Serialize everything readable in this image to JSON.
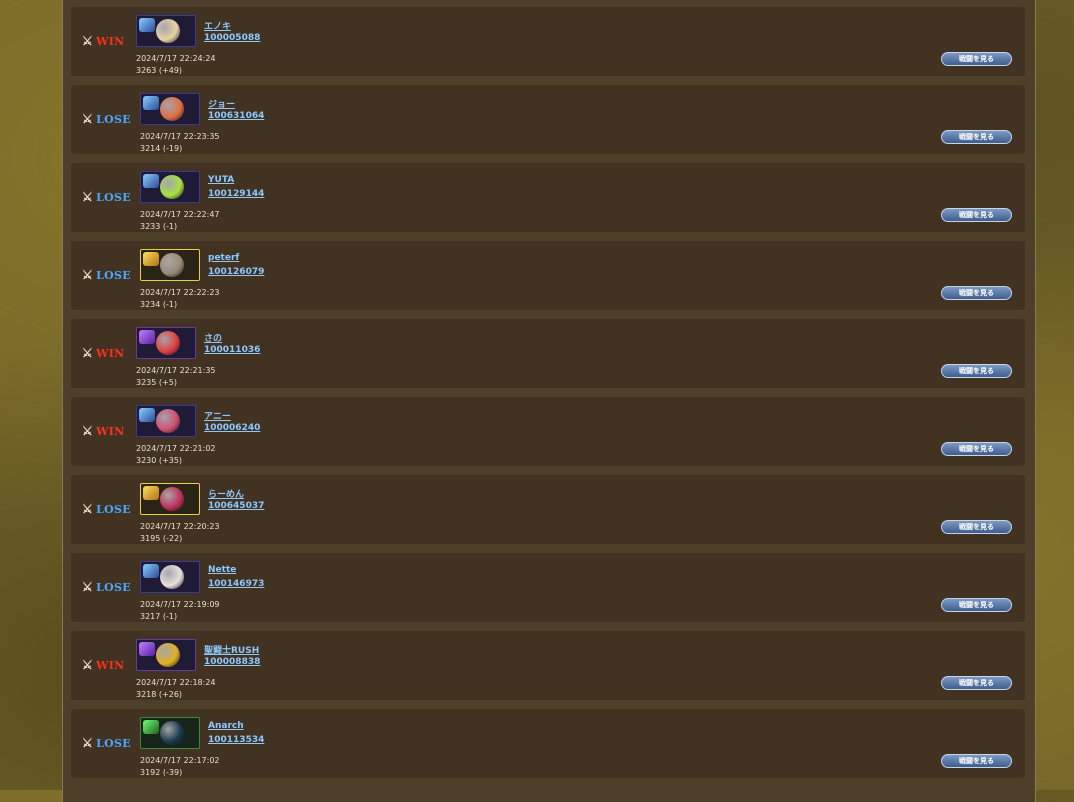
{
  "battles": [
    {
      "result": "WIN",
      "name": "エノキ",
      "player_id": "100005088",
      "time": "2024/7/17 22:24:24",
      "rating": "3263 (+49)",
      "button": "戦闘を見る",
      "frame": "blue",
      "orb": "#e8d2a0"
    },
    {
      "result": "LOSE",
      "name": "ジョー",
      "player_id": "100631064",
      "time": "2024/7/17 22:23:35",
      "rating": "3214 (-19)",
      "button": "戦闘を見る",
      "frame": "blue",
      "orb": "#e07040"
    },
    {
      "result": "LOSE",
      "name": "YUTA",
      "player_id": "100129144",
      "time": "2024/7/17 22:22:47",
      "rating": "3233 (-1)",
      "button": "戦闘を見る",
      "frame": "blue",
      "orb": "#a8e040"
    },
    {
      "result": "LOSE",
      "name": "peterf",
      "player_id": "100126079",
      "time": "2024/7/17 22:22:23",
      "rating": "3234 (-1)",
      "button": "戦闘を見る",
      "frame": "gold",
      "orb": "#9a8a7a"
    },
    {
      "result": "WIN",
      "name": "さの",
      "player_id": "100011036",
      "time": "2024/7/17 22:21:35",
      "rating": "3235 (+5)",
      "button": "戦闘を見る",
      "frame": "purple",
      "orb": "#e04040"
    },
    {
      "result": "WIN",
      "name": "アニー",
      "player_id": "100006240",
      "time": "2024/7/17 22:21:02",
      "rating": "3230 (+35)",
      "button": "戦闘を見る",
      "frame": "blue",
      "orb": "#d05070"
    },
    {
      "result": "LOSE",
      "name": "らーめん",
      "player_id": "100645037",
      "time": "2024/7/17 22:20:23",
      "rating": "3195 (-22)",
      "button": "戦闘を見る",
      "frame": "gold",
      "orb": "#c03060"
    },
    {
      "result": "LOSE",
      "name": "Nette",
      "player_id": "100146973",
      "time": "2024/7/17 22:19:09",
      "rating": "3217 (-1)",
      "button": "戦闘を見る",
      "frame": "blue",
      "orb": "#e8e0d8"
    },
    {
      "result": "WIN",
      "name": "聖闘士RUSH",
      "player_id": "100008838",
      "time": "2024/7/17 22:18:24",
      "rating": "3218 (+26)",
      "button": "戦闘を見る",
      "frame": "purple",
      "orb": "#e0b020"
    },
    {
      "result": "LOSE",
      "name": "Anarch",
      "player_id": "100113534",
      "time": "2024/7/17 22:17:02",
      "rating": "3192 (-39)",
      "button": "戦闘を見る",
      "frame": "green",
      "orb": "#1a3a50"
    }
  ],
  "colors": {
    "win": "#ff3020",
    "lose": "#4aa8ff",
    "link": "#8ec8ff"
  },
  "icons": {
    "result": "crossed-swords-icon"
  }
}
